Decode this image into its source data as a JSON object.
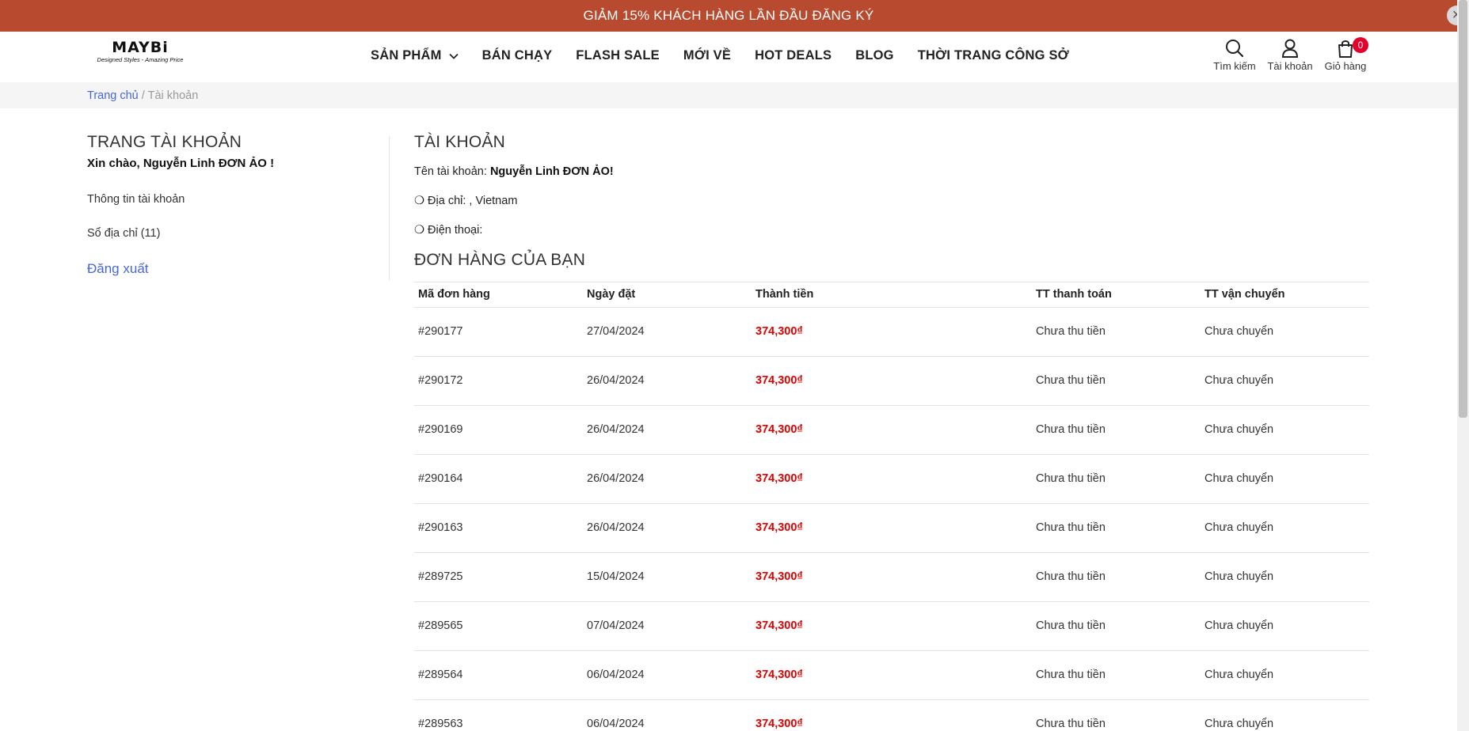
{
  "promo": {
    "text": "GIẢM 15% KHÁCH HÀNG LẦN ĐẦU ĐĂNG KÝ",
    "close": "×"
  },
  "logo": {
    "main": "MAYBi",
    "tagline": "Designed Styles - Amazing Price"
  },
  "nav": [
    {
      "label": "SẢN PHẨM",
      "has_dropdown": true
    },
    {
      "label": "BÁN CHẠY"
    },
    {
      "label": "FLASH SALE"
    },
    {
      "label": "MỚI VỀ"
    },
    {
      "label": "HOT DEALS"
    },
    {
      "label": "BLOG"
    },
    {
      "label": "THỜI TRANG CÔNG SỞ"
    }
  ],
  "header_actions": {
    "search": {
      "label": "Tìm kiếm",
      "icon": "search-icon"
    },
    "account": {
      "label": "Tài khoản",
      "icon": "user-icon"
    },
    "cart": {
      "label": "Giỏ hàng",
      "icon": "shopping-bag-icon",
      "count": "0"
    }
  },
  "breadcrumb": {
    "home": "Trang chủ",
    "separator": "/",
    "current": "Tài khoản"
  },
  "sidebar": {
    "title": "TRANG TÀI KHOẢN",
    "greeting": "Xin chào, Nguyễn Linh ĐƠN ẢO !",
    "links": [
      "Thông tin tài khoản",
      "Sổ địa chỉ (11)"
    ],
    "logout": "Đăng xuất"
  },
  "account": {
    "title": "TÀI KHOẢN",
    "name_label": "Tên tài khoản:",
    "name_value": "Nguyễn Linh ĐƠN ẢO!",
    "address_label": "❍ Địa chỉ: , Vietnam",
    "phone_label": "❍ Điện thoại:"
  },
  "orders": {
    "title": "ĐƠN HÀNG CỦA BẠN",
    "columns": [
      "Mã đơn hàng",
      "Ngày đặt",
      "Thành tiền",
      "TT thanh toán",
      "TT vận chuyển"
    ],
    "rows": [
      {
        "id": "#290177",
        "date": "27/04/2024",
        "total": "374,300₫",
        "payment": "Chưa thu tiền",
        "shipping": "Chưa chuyển"
      },
      {
        "id": "#290172",
        "date": "26/04/2024",
        "total": "374,300₫",
        "payment": "Chưa thu tiền",
        "shipping": "Chưa chuyển"
      },
      {
        "id": "#290169",
        "date": "26/04/2024",
        "total": "374,300₫",
        "payment": "Chưa thu tiền",
        "shipping": "Chưa chuyển"
      },
      {
        "id": "#290164",
        "date": "26/04/2024",
        "total": "374,300₫",
        "payment": "Chưa thu tiền",
        "shipping": "Chưa chuyển"
      },
      {
        "id": "#290163",
        "date": "26/04/2024",
        "total": "374,300₫",
        "payment": "Chưa thu tiền",
        "shipping": "Chưa chuyển"
      },
      {
        "id": "#289725",
        "date": "15/04/2024",
        "total": "374,300₫",
        "payment": "Chưa thu tiền",
        "shipping": "Chưa chuyển"
      },
      {
        "id": "#289565",
        "date": "07/04/2024",
        "total": "374,300₫",
        "payment": "Chưa thu tiền",
        "shipping": "Chưa chuyển"
      },
      {
        "id": "#289564",
        "date": "06/04/2024",
        "total": "374,300₫",
        "payment": "Chưa thu tiền",
        "shipping": "Chưa chuyển"
      },
      {
        "id": "#289563",
        "date": "06/04/2024",
        "total": "374,300₫",
        "payment": "Chưa thu tiền",
        "shipping": "Chưa chuyển"
      }
    ]
  },
  "colors": {
    "promo_bg": "#b84a2f",
    "link": "#4767d8",
    "price": "#e30000",
    "badge": "#e4002b"
  }
}
